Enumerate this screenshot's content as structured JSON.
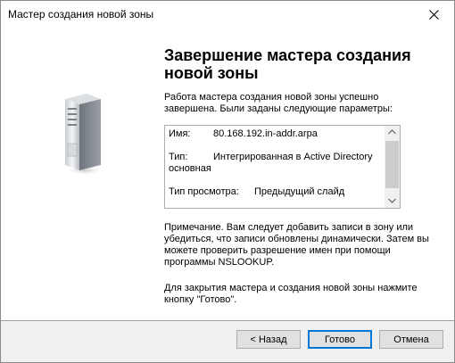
{
  "window": {
    "title": "Мастер создания новой зоны"
  },
  "icons": {
    "close": "close-icon",
    "server": "server-icon",
    "scroll_up": "chevron-up-icon",
    "scroll_down": "chevron-down-icon"
  },
  "main": {
    "heading": "Завершение мастера создания новой зоны",
    "intro": "Работа мастера создания новой зоны успешно завершена. Были заданы следующие параметры:",
    "summary": {
      "name_label": "Имя:",
      "name_value": "80.168.192.in-addr.arpa",
      "type_label": "Тип:",
      "type_value_1": "Интегрированная в Active Directory",
      "type_value_2": "основная",
      "lookup_label": "Тип просмотра:",
      "lookup_value": "Предыдущий слайд"
    },
    "note": "Примечание. Вам следует добавить записи в зону или убедиться, что записи обновлены динамически. Затем вы можете проверить разрешение имен при помощи программы NSLOOKUP.",
    "closing": "Для закрытия мастера и создания новой зоны нажмите кнопку \"Готово\"."
  },
  "footer": {
    "back_label": "< Назад",
    "finish_label": "Готово",
    "cancel_label": "Отмена"
  },
  "colors": {
    "footer_bg": "#f0f0f0",
    "default_button_border": "#0078d7"
  }
}
